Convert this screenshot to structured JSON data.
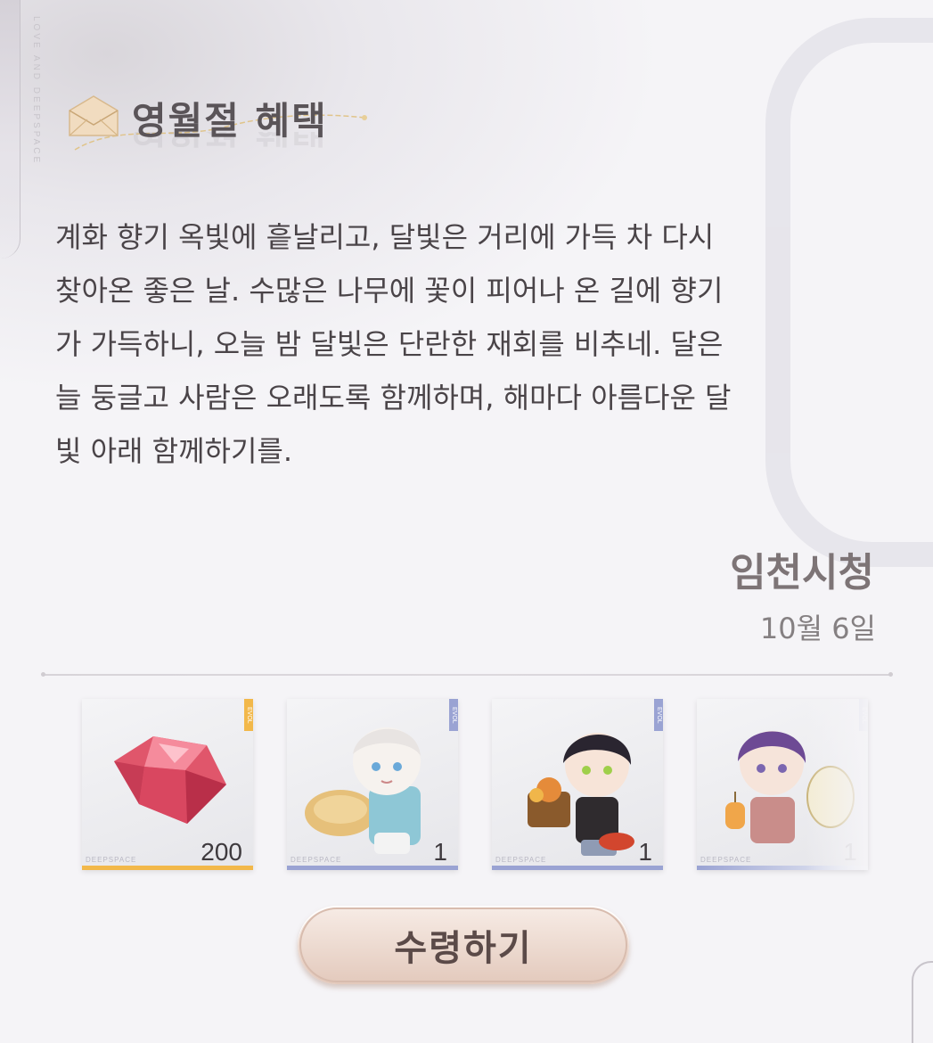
{
  "side_text": "LOVE AND DEEPSPACE",
  "header": {
    "title": "영월절 혜택"
  },
  "letter": {
    "lines": [
      "계화 향기 옥빛에 흩날리고, 달빛은 거리에 가득 차 다시",
      "찾아온 좋은 날. 수많은 나무에 꽃이 피어나 온 길에 향기",
      "가 가득하니, 오늘 밤 달빛은 단란한 재회를 비추네. 달은",
      "늘 둥글고 사람은 오래도록 함께하며, 해마다 아름다운 달",
      "빛 아래 함께하기를."
    ],
    "signature": "임천시청",
    "date": "10월 6일"
  },
  "rewards": [
    {
      "name": "gem",
      "quantity": "200",
      "brand": "DEEPSPACE",
      "tag": "EVOL",
      "accent": "#f2b84a"
    },
    {
      "name": "chibi-silver-hair",
      "quantity": "1",
      "brand": "DEEPSPACE",
      "tag": "EVOL",
      "accent": "#9aa3d3"
    },
    {
      "name": "chibi-dark-hair",
      "quantity": "1",
      "brand": "DEEPSPACE",
      "tag": "EVOL",
      "accent": "#9aa3d3"
    },
    {
      "name": "chibi-purple-hair",
      "quantity": "1",
      "brand": "DEEPSPACE",
      "tag": "EVOL",
      "accent": "#9aa3d3"
    }
  ],
  "claim_button": {
    "label": "수령하기"
  }
}
